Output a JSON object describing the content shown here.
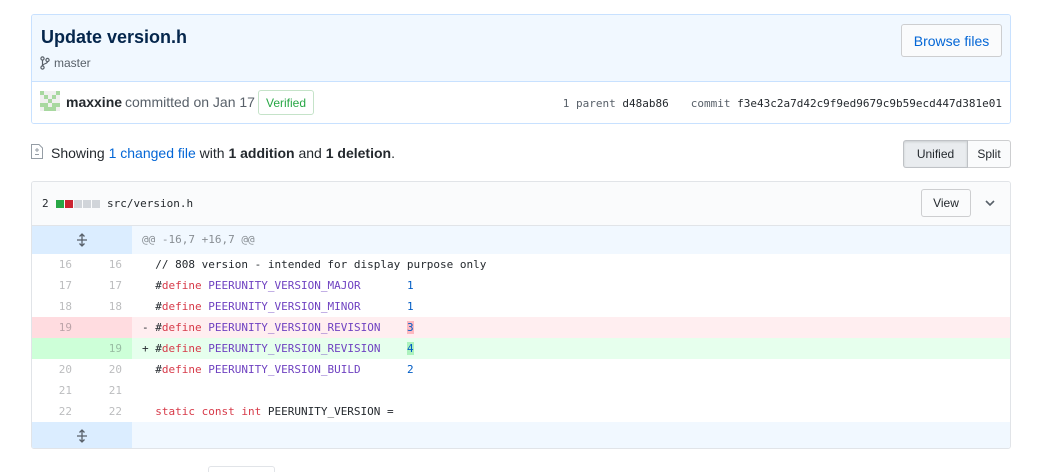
{
  "commit": {
    "title": "Update version.h",
    "branch": "master",
    "browse_label": "Browse files",
    "author": "maxxine",
    "committed_text": "committed on Jan 17",
    "verified_label": "Verified",
    "parent_label": "1 parent",
    "parent_sha": "d48ab86",
    "commit_label": "commit",
    "commit_sha": "f3e43c2a7d42c9f9ed9679c9b59ecd447d381e01"
  },
  "summary": {
    "showing": "Showing",
    "changed_files": "1 changed file",
    "with": "with",
    "additions": "1 addition",
    "and": "and",
    "deletions": "1 deletion",
    "period": ".",
    "unified_label": "Unified",
    "split_label": "Split"
  },
  "file": {
    "diffstat": "2",
    "path": "src/version.h",
    "view_label": "View",
    "hunk_header": "@@ -16,7 +16,7 @@",
    "lines": [
      {
        "old": "16",
        "new": "16",
        "prefix": " ",
        "kind": "ctx",
        "text": "// 808 version - intended for display purpose only"
      },
      {
        "old": "17",
        "new": "17",
        "prefix": " ",
        "kind": "ctx",
        "pp": "#",
        "kw": "define",
        "macro": "PEERUNITY_VERSION_MAJOR",
        "pad": "       ",
        "val": "1"
      },
      {
        "old": "18",
        "new": "18",
        "prefix": " ",
        "kind": "ctx",
        "pp": "#",
        "kw": "define",
        "macro": "PEERUNITY_VERSION_MINOR",
        "pad": "       ",
        "val": "1"
      },
      {
        "old": "19",
        "new": "",
        "prefix": "-",
        "kind": "del",
        "pp": "#",
        "kw": "define",
        "macro": "PEERUNITY_VERSION_REVISION",
        "pad": "    ",
        "val": "3"
      },
      {
        "old": "",
        "new": "19",
        "prefix": "+",
        "kind": "add",
        "pp": "#",
        "kw": "define",
        "macro": "PEERUNITY_VERSION_REVISION",
        "pad": "    ",
        "val": "4"
      },
      {
        "old": "20",
        "new": "20",
        "prefix": " ",
        "kind": "ctx",
        "pp": "#",
        "kw": "define",
        "macro": "PEERUNITY_VERSION_BUILD",
        "pad": "       ",
        "val": "2"
      },
      {
        "old": "21",
        "new": "21",
        "prefix": " ",
        "kind": "ctx",
        "text": ""
      },
      {
        "old": "22",
        "new": "22",
        "prefix": " ",
        "kind": "ctx",
        "kw1": "static const int",
        "rest": " PEERUNITY_VERSION ="
      }
    ]
  },
  "colors": {
    "link": "#0366d6",
    "verified": "#28a745",
    "addition": "#28a745",
    "deletion": "#cb2431"
  },
  "icons": [
    "branch-icon",
    "avatar",
    "file-diff-icon",
    "expand-icon",
    "chevron-down-icon"
  ]
}
